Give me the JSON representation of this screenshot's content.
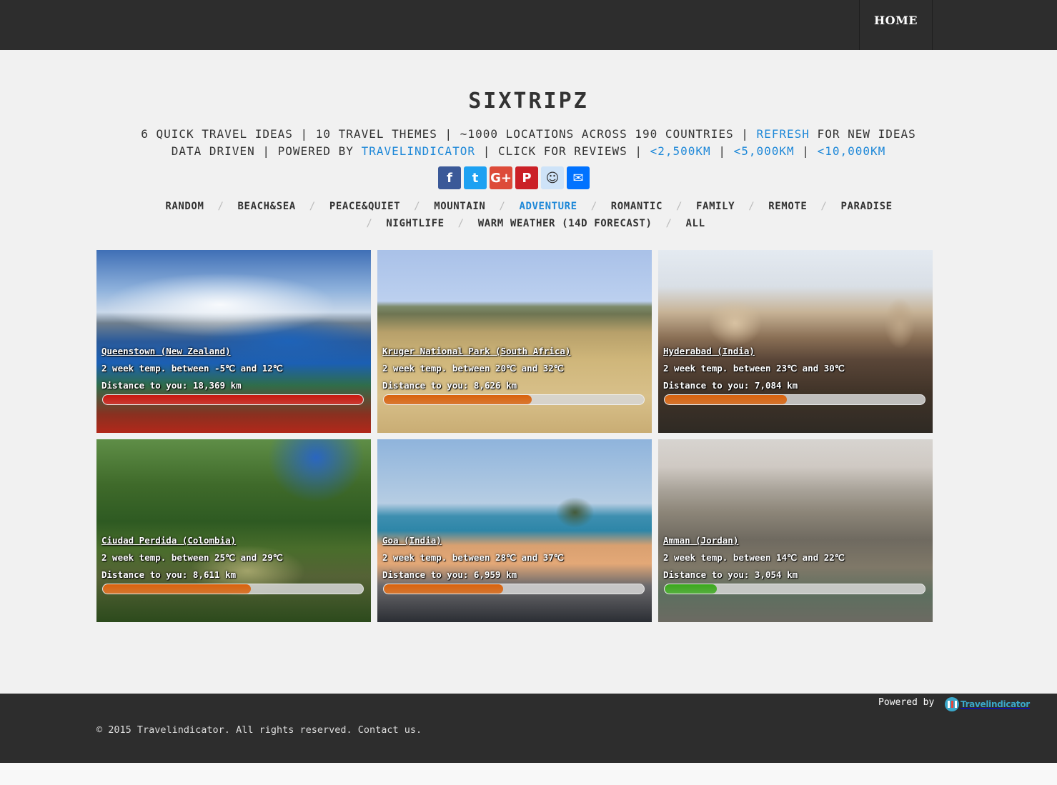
{
  "nav": {
    "home_label": "HOME"
  },
  "header": {
    "title": "SIXTRIPZ",
    "tagline1": {
      "prefix": "6 QUICK TRAVEL IDEAS | 10 TRAVEL THEMES | ~1000 LOCATIONS ACROSS 190 COUNTRIES | ",
      "refresh_link": "REFRESH",
      "suffix": " FOR NEW IDEAS"
    },
    "tagline2": {
      "prefix": "DATA DRIVEN | POWERED BY ",
      "powered_link": "TRAVELINDICATOR",
      "middle": " | CLICK FOR REVIEWS | ",
      "dist1": "<2,500KM",
      "sep1": " | ",
      "dist2": "<5,000KM",
      "sep2": " | ",
      "dist3": "<10,000KM"
    }
  },
  "share": [
    {
      "icon": "facebook-icon",
      "glyph": "f",
      "color": "#3b5998"
    },
    {
      "icon": "twitter-icon",
      "glyph": "t",
      "color": "#1da1f2"
    },
    {
      "icon": "google-plus-icon",
      "glyph": "G+",
      "color": "#dd4b39"
    },
    {
      "icon": "pinterest-icon",
      "glyph": "P",
      "color": "#cb2027"
    },
    {
      "icon": "reddit-icon",
      "glyph": "☺",
      "color": "#cee3f8"
    },
    {
      "icon": "email-icon",
      "glyph": "✉",
      "color": "#0072ff"
    }
  ],
  "categories": {
    "row1": [
      "RANDOM",
      "BEACH&SEA",
      "PEACE&QUIET",
      "MOUNTAIN",
      "ADVENTURE",
      "ROMANTIC",
      "FAMILY",
      "REMOTE",
      "PARADISE"
    ],
    "row2": [
      "NIGHTLIFE",
      "WARM WEATHER (14D FORECAST)",
      "ALL"
    ],
    "active": "ADVENTURE",
    "separator": "/"
  },
  "destinations": [
    {
      "name": "Queenstown (New Zealand)",
      "temp": "2 week temp. between -5℃ and 12℃",
      "distance": "Distance to you: 18,369 km",
      "distance_fraction": 1.0,
      "bar_color": "#c8180f"
    },
    {
      "name": "Kruger National Park (South Africa)",
      "temp": "2 week temp. between 20℃ and 32℃",
      "distance": "Distance to you: 8,626 km",
      "distance_fraction": 0.57,
      "bar_color": "#d9620c"
    },
    {
      "name": "Hyderabad (India)",
      "temp": "2 week temp. between 23℃ and 30℃",
      "distance": "Distance to you: 7,084 km",
      "distance_fraction": 0.47,
      "bar_color": "#d9620c"
    },
    {
      "name": "Ciudad Perdida (Colombia)",
      "temp": "2 week temp. between 25℃ and 29℃",
      "distance": "Distance to you: 8,611 km",
      "distance_fraction": 0.57,
      "bar_color": "#d9620c"
    },
    {
      "name": "Goa (India)",
      "temp": "2 week temp. between 28℃ and 37℃",
      "distance": "Distance to you: 6,959 km",
      "distance_fraction": 0.46,
      "bar_color": "#d9620c"
    },
    {
      "name": "Amman (Jordan)",
      "temp": "2 week temp. between 14℃ and 22℃",
      "distance": "Distance to you: 3,054 km",
      "distance_fraction": 0.2,
      "bar_color": "#3aa81c"
    }
  ],
  "footer": {
    "powered_by": "Powered by",
    "logo_text": "Travelindicator",
    "copyright": "© 2015 Travelindicator. All rights reserved. Contact us."
  }
}
